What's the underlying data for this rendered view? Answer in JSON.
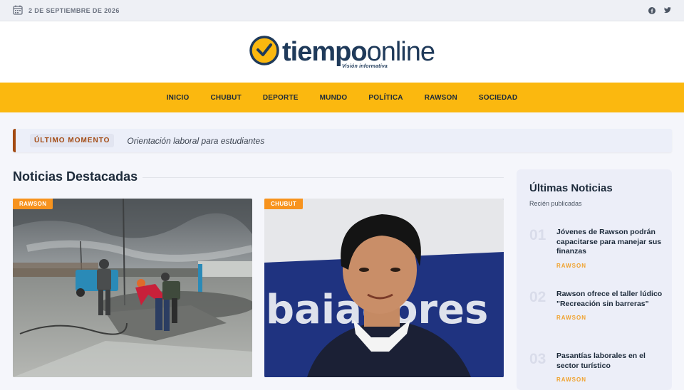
{
  "topbar": {
    "date": "2 DE SEPTIEMBRE DE 2026",
    "icons": [
      "calendar-icon",
      "facebook-icon",
      "twitter-icon"
    ]
  },
  "logo": {
    "text_bold": "tiempo",
    "text_light": "online",
    "tagline": "Visión informativa"
  },
  "nav": {
    "items": [
      "INICIO",
      "CHUBUT",
      "DEPORTE",
      "MUNDO",
      "POLÍTICA",
      "RAWSON",
      "SOCIEDAD"
    ]
  },
  "breaking": {
    "label": "ÚLTIMO MOMENTO",
    "headline": "Orientación laboral para estudiantes"
  },
  "featured": {
    "title": "Noticias Destacadas",
    "cards": [
      {
        "category": "RAWSON"
      },
      {
        "category": "CHUBUT"
      }
    ]
  },
  "sidebar": {
    "title": "Últimas Noticias",
    "subtitle": "Recién publicadas",
    "items": [
      {
        "num": "01",
        "title": "Jóvenes de Rawson podrán capacitarse para manejar sus finanzas",
        "category": "RAWSON"
      },
      {
        "num": "02",
        "title": "Rawson ofrece el taller lúdico \"Recreación sin barreras\"",
        "category": "RAWSON"
      },
      {
        "num": "03",
        "title": "Pasantías laborales en el sector turístico",
        "category": "RAWSON"
      }
    ]
  },
  "colors": {
    "accent": "#fbb80f",
    "category_badge": "#f7931e",
    "breaking_border": "#a34a12",
    "navy": "#1f3a5a"
  }
}
